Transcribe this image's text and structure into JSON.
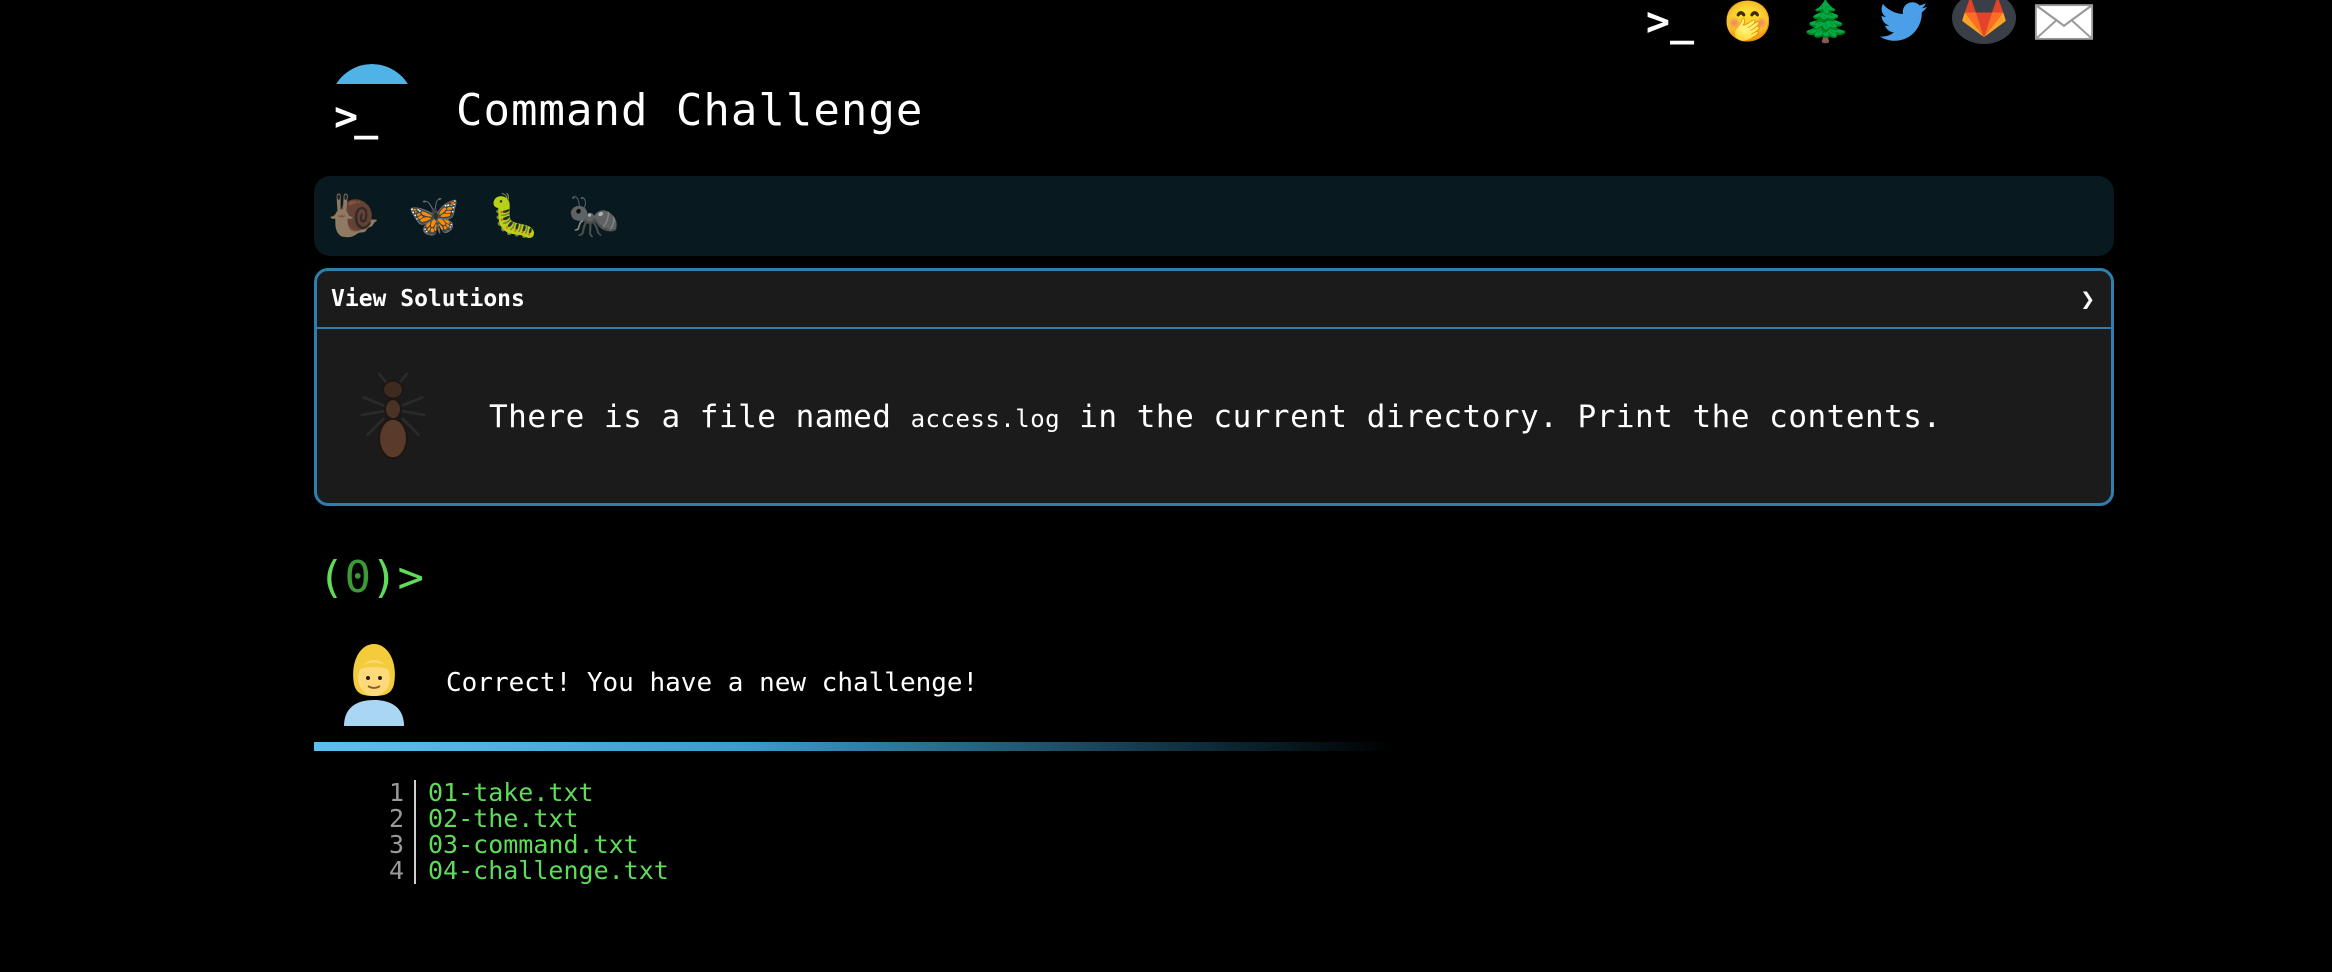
{
  "nav": {
    "prompt_label": ">_",
    "items": [
      {
        "name": "prompt-home-icon"
      },
      {
        "name": "shushing-face-icon",
        "glyph": "🤭"
      },
      {
        "name": "tree-icon",
        "glyph": "🌲"
      },
      {
        "name": "twitter-icon"
      },
      {
        "name": "gitlab-icon"
      },
      {
        "name": "envelope-icon",
        "glyph": "✉"
      }
    ]
  },
  "header": {
    "logo_prompt": ">_",
    "title": "Command Challenge"
  },
  "levels": [
    {
      "name": "snail-icon",
      "glyph": "🐌",
      "done": true
    },
    {
      "name": "butterfly-icon",
      "glyph": "🦋",
      "done": false
    },
    {
      "name": "caterpillar-icon",
      "glyph": "🐛",
      "done": false
    },
    {
      "name": "ant-icon",
      "glyph": "🐜",
      "done": false
    }
  ],
  "challenge": {
    "solutions_label": "View Solutions",
    "chevron": "❯",
    "text_before": "There is a file named ",
    "filename": "access.log",
    "text_after": " in the current directory. Print the contents."
  },
  "prompt": {
    "open": "(",
    "count": "0",
    "close": ")>",
    "value": ""
  },
  "response": {
    "message": "Correct! You have a new challenge!"
  },
  "output": {
    "lines": [
      {
        "no": "1",
        "text": "01-take.txt"
      },
      {
        "no": "2",
        "text": "02-the.txt"
      },
      {
        "no": "3",
        "text": "03-command.txt"
      },
      {
        "no": "4",
        "text": "04-challenge.txt"
      }
    ]
  },
  "colors": {
    "accent": "#2e7fae",
    "prompt_green": "#5fdc5a",
    "panel_bg": "#1b1b1b",
    "level_bar_bg": "#08191f"
  }
}
